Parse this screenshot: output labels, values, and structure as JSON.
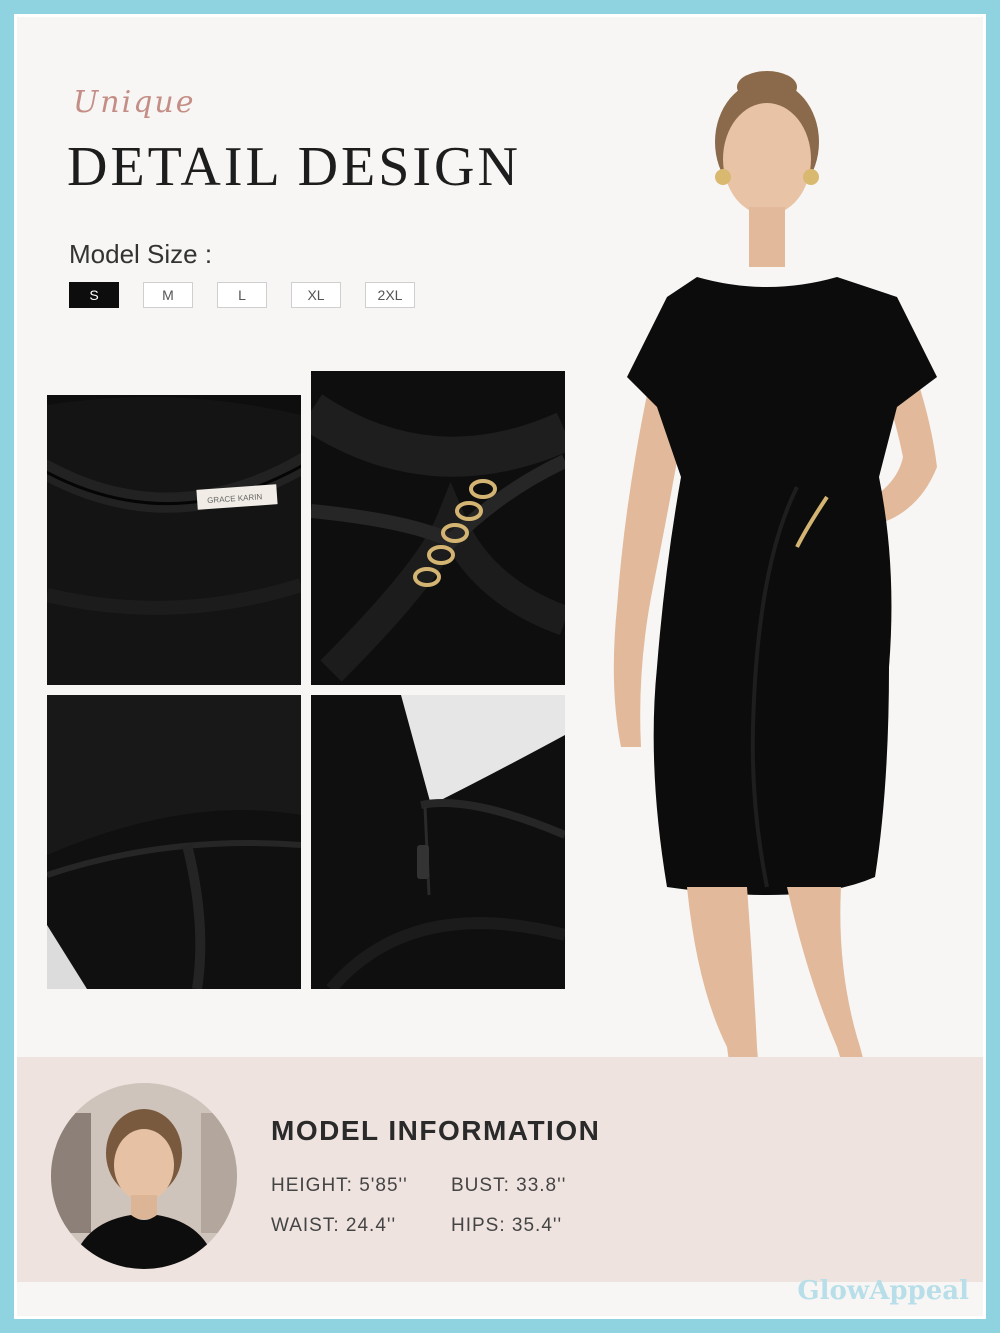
{
  "header": {
    "script_title": "Unique",
    "title": "DETAIL DESIGN"
  },
  "sizes": {
    "label": "Model Size :",
    "options": [
      "S",
      "M",
      "L",
      "XL",
      "2XL"
    ],
    "selected": "S"
  },
  "details": {
    "label_tag": "GRACE KARIN"
  },
  "model_info": {
    "title": "MODEL INFORMATION",
    "height": "HEIGHT: 5'85''",
    "bust": "BUST: 33.8''",
    "waist": "WAIST: 24.4''",
    "hips": "HIPS: 35.4''"
  },
  "watermark": "GlowAppeal",
  "colors": {
    "frame": "#8fd3e0",
    "background": "#f7f6f4",
    "accent_script": "#c48e86",
    "dress": "#0c0c0c",
    "info_band": "#eee3df"
  }
}
